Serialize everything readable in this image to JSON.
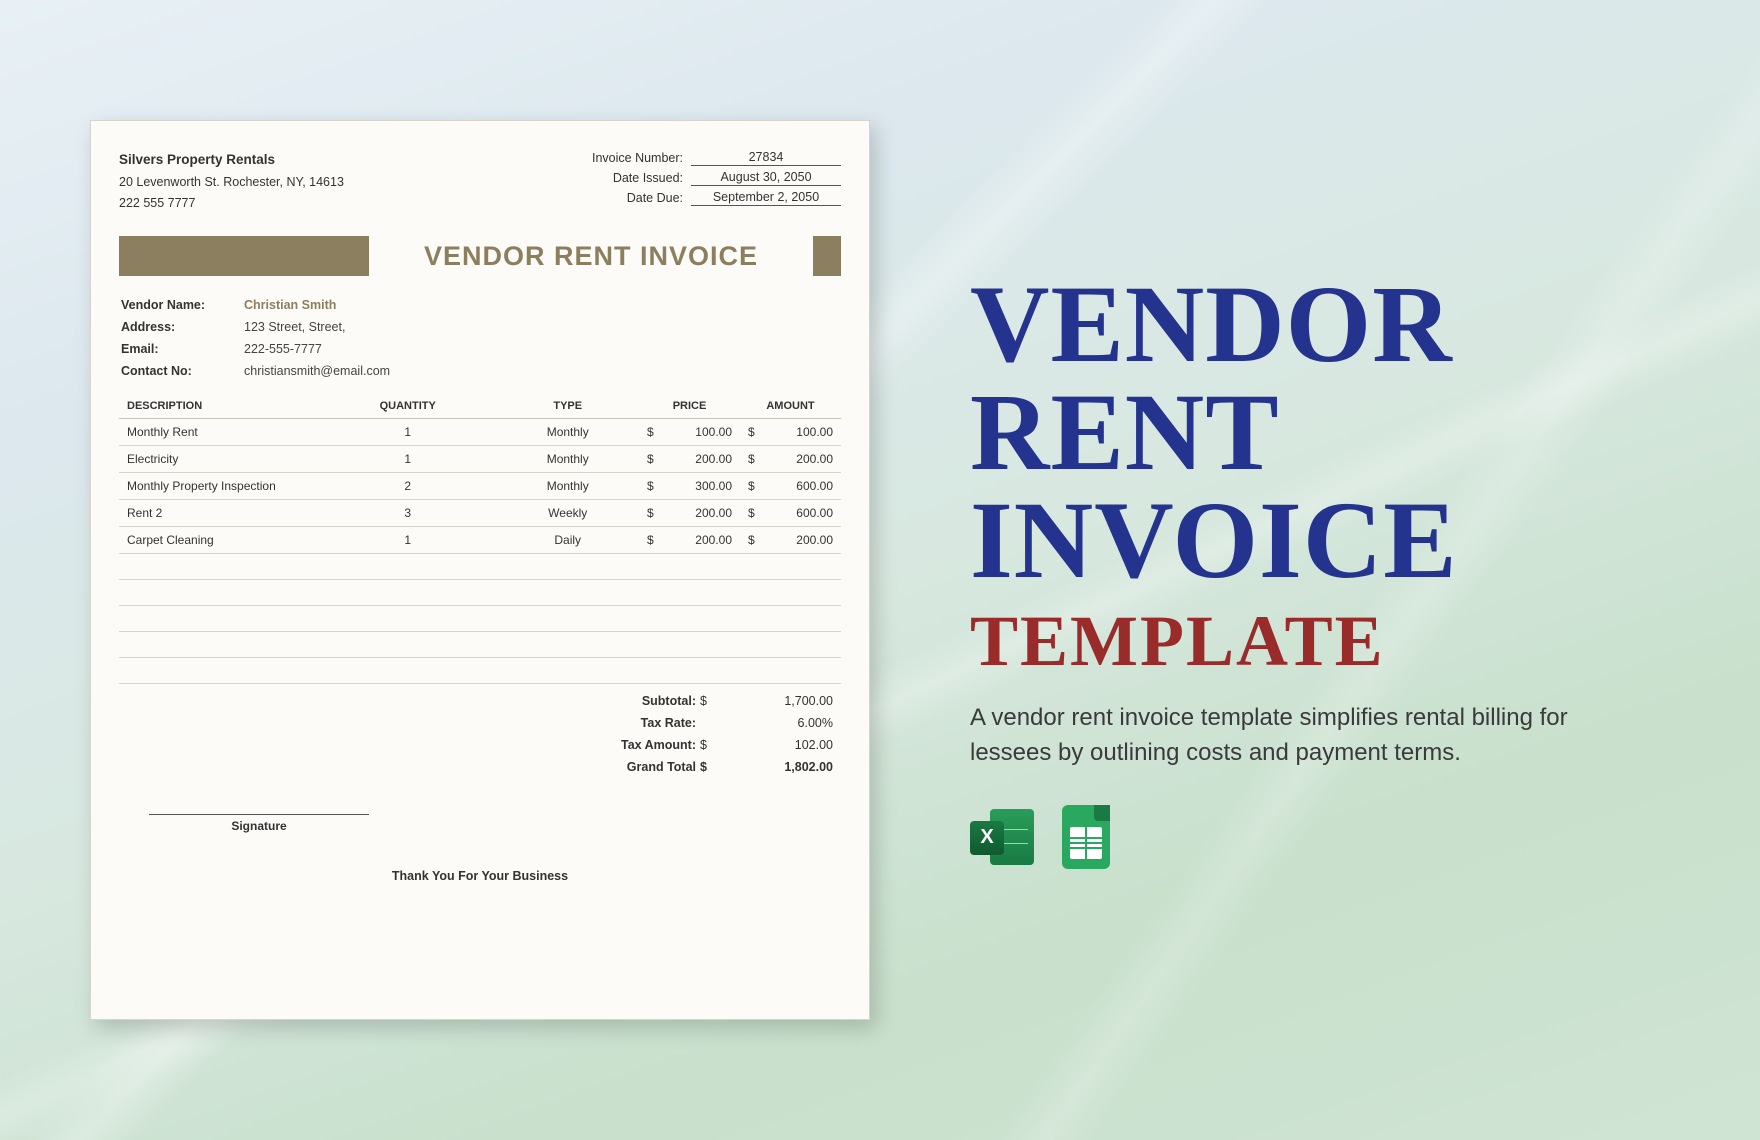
{
  "invoice": {
    "company": {
      "name": "Silvers Property Rentals",
      "address": "20 Levenworth St. Rochester, NY, 14613",
      "phone": "222 555 7777"
    },
    "meta": {
      "invoice_number_label": "Invoice Number:",
      "invoice_number": "27834",
      "date_issued_label": "Date Issued:",
      "date_issued": "August 30, 2050",
      "date_due_label": "Date Due:",
      "date_due": "September 2, 2050"
    },
    "title": "VENDOR RENT INVOICE",
    "vendor": {
      "name_label": "Vendor Name:",
      "name": "Christian Smith",
      "address_label": "Address:",
      "address": "123 Street, Street,",
      "email_label": "Email:",
      "email": "222-555-7777",
      "contact_label": "Contact No:",
      "contact": "christiansmith@email.com"
    },
    "table": {
      "headers": {
        "description": "DESCRIPTION",
        "quantity": "QUANTITY",
        "type": "Type",
        "price": "PRICE",
        "amount": "AMOUNT"
      },
      "rows": [
        {
          "description": "Monthly Rent",
          "quantity": "1",
          "type": "Monthly",
          "price": "100.00",
          "amount": "100.00"
        },
        {
          "description": "Electricity",
          "quantity": "1",
          "type": "Monthly",
          "price": "200.00",
          "amount": "200.00"
        },
        {
          "description": "Monthly Property Inspection",
          "quantity": "2",
          "type": "Monthly",
          "price": "300.00",
          "amount": "600.00"
        },
        {
          "description": "Rent 2",
          "quantity": "3",
          "type": "Weekly",
          "price": "200.00",
          "amount": "600.00"
        },
        {
          "description": "Carpet Cleaning",
          "quantity": "1",
          "type": "Daily",
          "price": "200.00",
          "amount": "200.00"
        }
      ],
      "currency": "$"
    },
    "totals": {
      "subtotal_label": "Subtotal:",
      "subtotal": "1,700.00",
      "tax_rate_label": "Tax Rate:",
      "tax_rate": "6.00%",
      "tax_amount_label": "Tax Amount:",
      "tax_amount": "102.00",
      "grand_total_label": "Grand Total",
      "grand_total": "1,802.00"
    },
    "signature_label": "Signature",
    "footer": "Thank You For Your Business"
  },
  "promo": {
    "title_line1": "VENDOR",
    "title_line2": "RENT",
    "title_line3": "INVOICE",
    "subtitle": "TEMPLATE",
    "description": "A vendor rent invoice template simplifies rental billing for lessees by outlining costs and payment terms.",
    "icons": {
      "excel_letter": "X"
    }
  }
}
